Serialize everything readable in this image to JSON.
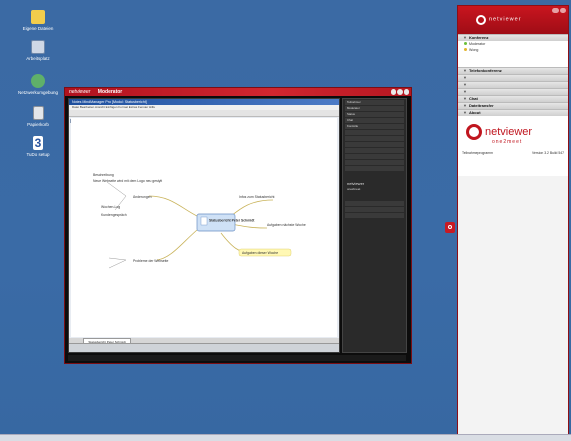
{
  "desktop": {
    "icons": [
      {
        "label": "Eigene Dateien",
        "icon": "folder-icon"
      },
      {
        "label": "Arbeitsplatz",
        "icon": "computer-icon"
      },
      {
        "label": "Netzwerkumgebung",
        "icon": "network-icon"
      },
      {
        "label": "Papierkorb",
        "icon": "recycle-bin-icon"
      },
      {
        "label": "TuDo setup",
        "icon": "setup-icon"
      }
    ]
  },
  "netviewer_window": {
    "logo": "netviewer",
    "title": "Moderator",
    "app_title": "Notes MindManager Pro [Modul: Statusbericht]",
    "menu": "Datei  Bearbeiten  Ansicht  Einfügen  Format  Extras  Fenster  Hilfe",
    "tab": "Statusbericht Peter Schmidt",
    "mindmap": {
      "center": "Statusbericht Peter Schmidt",
      "branches": [
        "Änderungen",
        "Infos zum Statusbericht",
        "Aufgaben nächste Woche",
        "Aufgaben dieser Woche",
        "Probleme der Webseite"
      ],
      "notes": [
        "Beschreibung",
        "Neue Webseite wird mit dem Logo neu gestylt",
        "Wochen-Log",
        "Kundengespräch"
      ]
    },
    "side_panel": {
      "rows": [
        "Teilnehmer",
        "Moderator",
        "Status",
        "Chat",
        "Kontrolle"
      ],
      "logo": "netviewer",
      "sub": "one2meet"
    }
  },
  "right_panel": {
    "header_logo": "netviewer",
    "sections": {
      "konferenz": "Konferenz",
      "telefonkonferenz": "Telefonkonferenz",
      "chat": "Chat",
      "dateitransfer": "Dateitransfer",
      "about": "About"
    },
    "participants": [
      "Moderator",
      "Wong"
    ],
    "about": {
      "brand": "netviewer",
      "product": "one2meet",
      "left": "Teilnahmeprogramm",
      "right": "Version 3.2 Build 547"
    }
  }
}
